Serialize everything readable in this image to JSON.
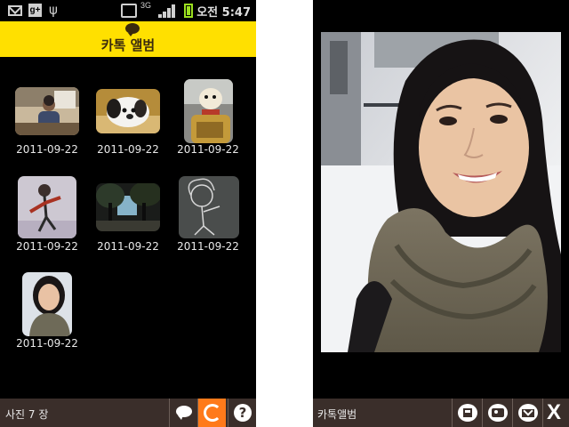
{
  "status_bar": {
    "time": "오전 5:47",
    "network": "3G",
    "icons": [
      "mail-icon",
      "google-plus-icon",
      "usb-icon",
      "vibrate-icon",
      "signal-icon",
      "battery-icon"
    ],
    "battery_color": "#9be01f"
  },
  "album_list": {
    "title": "카톡 앨범",
    "title_icon": "speech-bubble-icon",
    "header_color": "#ffe000",
    "items": [
      {
        "date": "2011-09-22",
        "thumb": "man-at-desk"
      },
      {
        "date": "2011-09-22",
        "thumb": "white-dog-lying"
      },
      {
        "date": "2011-09-22",
        "thumb": "dog-in-bag"
      },
      {
        "date": "2011-09-22",
        "thumb": "figure-drawing-on-wall"
      },
      {
        "date": "2011-09-22",
        "thumb": "dark-trees"
      },
      {
        "date": "2011-09-22",
        "thumb": "chalk-drawing"
      },
      {
        "date": "2011-09-22",
        "thumb": "woman-selfie"
      }
    ],
    "bottom": {
      "count_label": "사진 7 장",
      "buttons": [
        {
          "name": "chat-icon"
        },
        {
          "name": "refresh-icon",
          "active_color": "#ff7a1a"
        },
        {
          "name": "help-icon",
          "glyph": "?"
        }
      ]
    }
  },
  "photo_view": {
    "subject": "woman-in-scarf-selfie",
    "bottom": {
      "album_label": "카톡앨범",
      "buttons": [
        {
          "name": "save-icon"
        },
        {
          "name": "profile-icon"
        },
        {
          "name": "mail-icon"
        },
        {
          "name": "close-icon",
          "glyph": "X"
        }
      ]
    }
  }
}
